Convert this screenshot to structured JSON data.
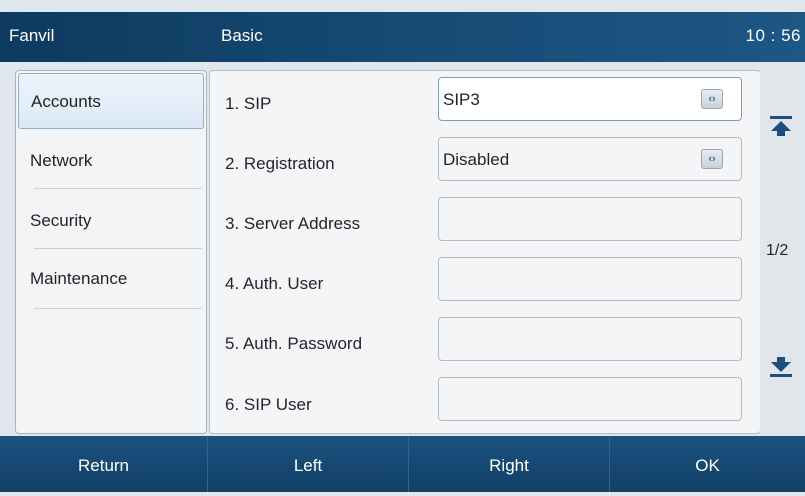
{
  "statusbar": {
    "brand": "Fanvil",
    "title": "Basic",
    "time": "10 : 56"
  },
  "sidebar": {
    "items": [
      {
        "label": "Accounts",
        "active": true
      },
      {
        "label": "Network"
      },
      {
        "label": "Security"
      },
      {
        "label": "Maintenance"
      }
    ]
  },
  "form": {
    "rows": [
      {
        "label": "1. SIP",
        "value": "SIP3"
      },
      {
        "label": "2. Registration",
        "value": "Disabled"
      },
      {
        "label": "3. Server Address",
        "value": ""
      },
      {
        "label": "4. Auth. User",
        "value": ""
      },
      {
        "label": "5. Auth. Password",
        "value": ""
      },
      {
        "label": "6. SIP User",
        "value": ""
      }
    ]
  },
  "pager": {
    "indicator": "1/2"
  },
  "softkeys": {
    "return": "Return",
    "left": "Left",
    "right": "Right",
    "ok": "OK"
  },
  "colors": {
    "header": "#174c76",
    "softkey": "#123f66",
    "accent": "#2f6aa3"
  }
}
